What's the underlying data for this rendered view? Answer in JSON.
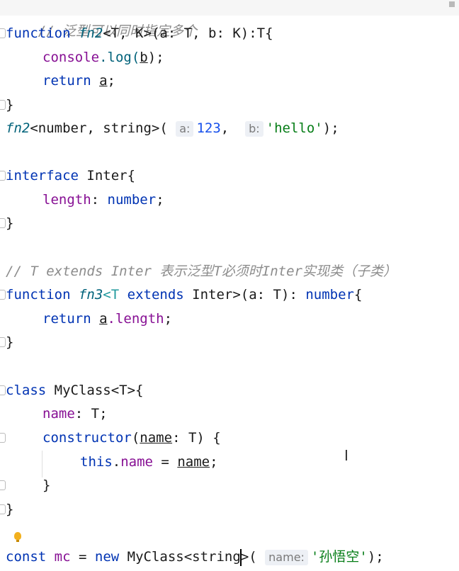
{
  "lines": {
    "l0_comment": "// 泛型可以同时指定多个",
    "l1_function": "function",
    "l1_fn": "fn2",
    "l1_rest": "<T, K>(a: T, b: K):T{",
    "l2_console": "console",
    "l2_log": ".log(",
    "l2_b": "b",
    "l2_end": ");",
    "l3_return": "return",
    "l3_a": "a",
    "l3_end": ";",
    "l4_brace": "}",
    "l5_fn": "fn2",
    "l5_types": "<number, string>(",
    "l5_hint_a": "a:",
    "l5_num": "123",
    "l5_comma": ",",
    "l5_hint_b": "b:",
    "l5_str": "'hello'",
    "l5_end": ");",
    "l7_interface": "interface",
    "l7_name": "Inter{",
    "l8_prop": "length",
    "l8_colon": ":",
    "l8_type": "number",
    "l8_semi": ";",
    "l9_brace": "}",
    "l11_comment": "// T extends Inter 表示泛型T必须时Inter实现类（子类）",
    "l12_function": "function",
    "l12_fn": "fn3",
    "l12_T": "<T",
    "l12_extends": "extends",
    "l12_rest": "Inter>(a: T):",
    "l12_ret": "number",
    "l12_brace": "{",
    "l13_return": "return",
    "l13_a": "a",
    "l13_len": ".length",
    "l13_semi": ";",
    "l14_brace": "}",
    "l16_class": "class",
    "l16_name": "MyClass<T>{",
    "l17_name": "name",
    "l17_rest": ": T;",
    "l18_ctor": "constructor",
    "l18_open": "(",
    "l18_param": "name",
    "l18_rest": ": T) {",
    "l19_this": "this",
    "l19_dot": ".",
    "l19_prop": "name",
    "l19_eq": " = ",
    "l19_name": "name",
    "l19_semi": ";",
    "l20_brace": "}",
    "l21_brace": "}",
    "l23_const": "const",
    "l23_mc": "mc",
    "l23_eq": " = ",
    "l23_new": "new",
    "l23_cls": "MyClass<string",
    "l23_gt": ">(",
    "l23_hint": "name:",
    "l23_str": "'孙悟空'",
    "l23_end": ");"
  },
  "colors": {
    "keyword": "#0033b3",
    "function": "#00627a",
    "type_param": "#20999d",
    "number": "#1750eb",
    "string": "#067d17",
    "comment": "#8c8c8c",
    "property": "#871094"
  },
  "icons": {
    "intention": "lightbulb-icon",
    "cursor": "text-cursor-icon"
  }
}
